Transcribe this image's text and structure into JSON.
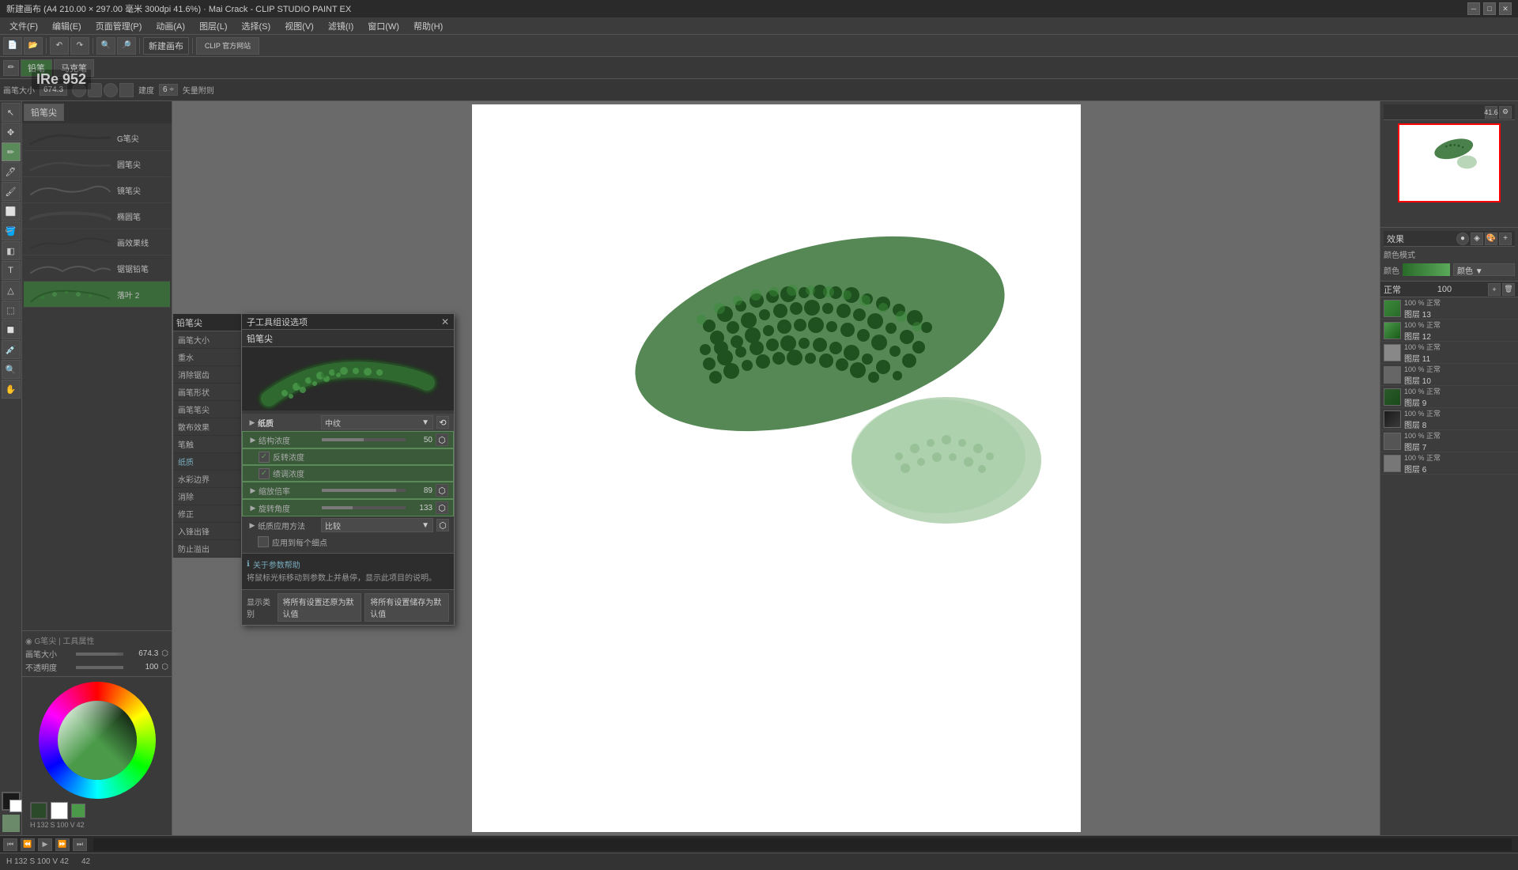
{
  "app": {
    "title": "新建画布 (A4 210.00 × 297.00 毫米 300dpi 41.6%) · Mai Crack - CLIP STUDIO PAINT EX",
    "win_min": "─",
    "win_max": "□",
    "win_close": "✕"
  },
  "titlebar": {
    "title": "新建画布 (A4 210.00 × 297.00 毫米 300dpi 41.6%) · Mai Crack - CLIP STUDIO PAINT EX"
  },
  "menubar": {
    "items": [
      "文件(F)",
      "编辑(E)",
      "页面管理(P)",
      "动画(A)",
      "图层(L)",
      "选择(S)",
      "视图(V)",
      "滤镜(I)",
      "窗口(W)",
      "帮助(H)"
    ]
  },
  "toolbar": {
    "new_canvas": "新建画布",
    "clip_btn": "CLIP 官方网站"
  },
  "subtool_bar": {
    "items": [
      "铅笔",
      "马克笔"
    ]
  },
  "tool_options": {
    "size_label": "画笔大小",
    "size_val": "674.3"
  },
  "brush_panel": {
    "title": "铅笔尖",
    "items": [
      {
        "name": "G笔尖",
        "active": false
      },
      {
        "name": "圆笔尖",
        "active": false
      },
      {
        "name": "镜笔尖",
        "active": false
      },
      {
        "name": "椭圆笔",
        "active": false
      },
      {
        "name": "画效果线",
        "active": false
      },
      {
        "name": "锯锯铅笔",
        "active": false
      },
      {
        "name": "落叶 2",
        "active": true
      }
    ],
    "size_label": "画笔大小",
    "size_val": "674.3",
    "opacity_label": "不透明度",
    "opacity_val": "100",
    "smooth_label": "消除锯齿"
  },
  "brush_settings_panel": {
    "title": "铅笔尖",
    "items": [
      {
        "label": "画笔大小",
        "active": false
      },
      {
        "label": "重水",
        "active": false
      },
      {
        "label": "消除锯齿",
        "active": false
      },
      {
        "label": "画笔形状",
        "active": false
      },
      {
        "label": "画笔笔尖",
        "active": false
      },
      {
        "label": "散布效果",
        "active": false
      },
      {
        "label": "笔触",
        "active": false
      },
      {
        "label": "纸质",
        "active": true
      },
      {
        "label": "水彩边界",
        "active": false
      },
      {
        "label": "消除",
        "active": false
      },
      {
        "label": "修正",
        "active": false
      },
      {
        "label": "入锋出锋",
        "active": false
      },
      {
        "label": "防止溢出",
        "active": false
      }
    ]
  },
  "subtool_panel": {
    "title": "子工具组设选项",
    "brush_name": "铅笔尖",
    "props": {
      "paper_texture": "纸质",
      "paper_texture_val": "中纹",
      "density_label": "结构浓度",
      "density_val": "50",
      "reverse_density": "反转浓度",
      "reverse_density_checked": true,
      "stretch_density": "绩调浓度",
      "stretch_density_checked": true,
      "scale_label": "缩放倍率",
      "scale_val": "89",
      "angle_label": "旋转角度",
      "angle_val": "133",
      "apply_method": "纸质应用方法",
      "apply_method_val": "比较",
      "apply_each": "应用到每个细点",
      "apply_each_checked": false
    },
    "help_title": "关于参数帮助",
    "help_text": "将鼠标光标移动到参数上并悬停，显示此项目的说明。",
    "show_types": "显示类别",
    "reset_btn": "将所有设置还原为默认值",
    "save_btn": "将所有设置储存为默认值"
  },
  "right_panel": {
    "effect_label": "效果",
    "color_mode_label": "颜色模式",
    "color_label": "颜色",
    "blend_mode_label": "正常",
    "opacity_val": "100",
    "layers": [
      {
        "name": "图层 13",
        "mode": "正常",
        "opacity": "100 %"
      },
      {
        "name": "图层 12",
        "mode": "正常",
        "opacity": "100 %"
      },
      {
        "name": "图层 11",
        "mode": "正常",
        "opacity": "100 %"
      },
      {
        "name": "图层 10",
        "mode": "正常",
        "opacity": "100 %"
      },
      {
        "name": "图层 9",
        "mode": "正常",
        "opacity": "100 %"
      },
      {
        "name": "图层 8",
        "mode": "正常",
        "opacity": "100 %"
      },
      {
        "name": "图层 7",
        "mode": "正常",
        "opacity": "100 %"
      },
      {
        "name": "图层 6",
        "mode": "正常",
        "opacity": "100 %"
      }
    ]
  },
  "statusbar": {
    "coords": "H 132 S 100 V 42",
    "zoom": "41.6%"
  },
  "ire_badge": "IRe 952",
  "color_section": {
    "label": "颜色"
  }
}
